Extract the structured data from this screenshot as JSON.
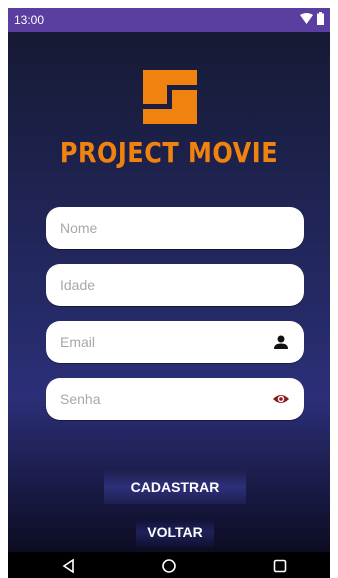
{
  "status": {
    "time": "13:00",
    "wifi_icon": "wifi-icon",
    "battery_icon": "battery-icon"
  },
  "brand": {
    "name": "PROJECT MOVIE",
    "color": "#f0820f"
  },
  "form": {
    "nome_placeholder": "Nome",
    "idade_placeholder": "Idade",
    "email_placeholder": "Email",
    "senha_placeholder": "Senha"
  },
  "icons": {
    "email": "person-icon",
    "senha": "eye-icon"
  },
  "buttons": {
    "cadastrar": "CADASTRAR",
    "voltar": "VOLTAR"
  },
  "nav": {
    "back": "back-icon",
    "home": "home-icon",
    "recents": "recents-icon"
  },
  "colors": {
    "status_bar": "#5a3ea0",
    "eye_icon": "#8b1a1a"
  }
}
